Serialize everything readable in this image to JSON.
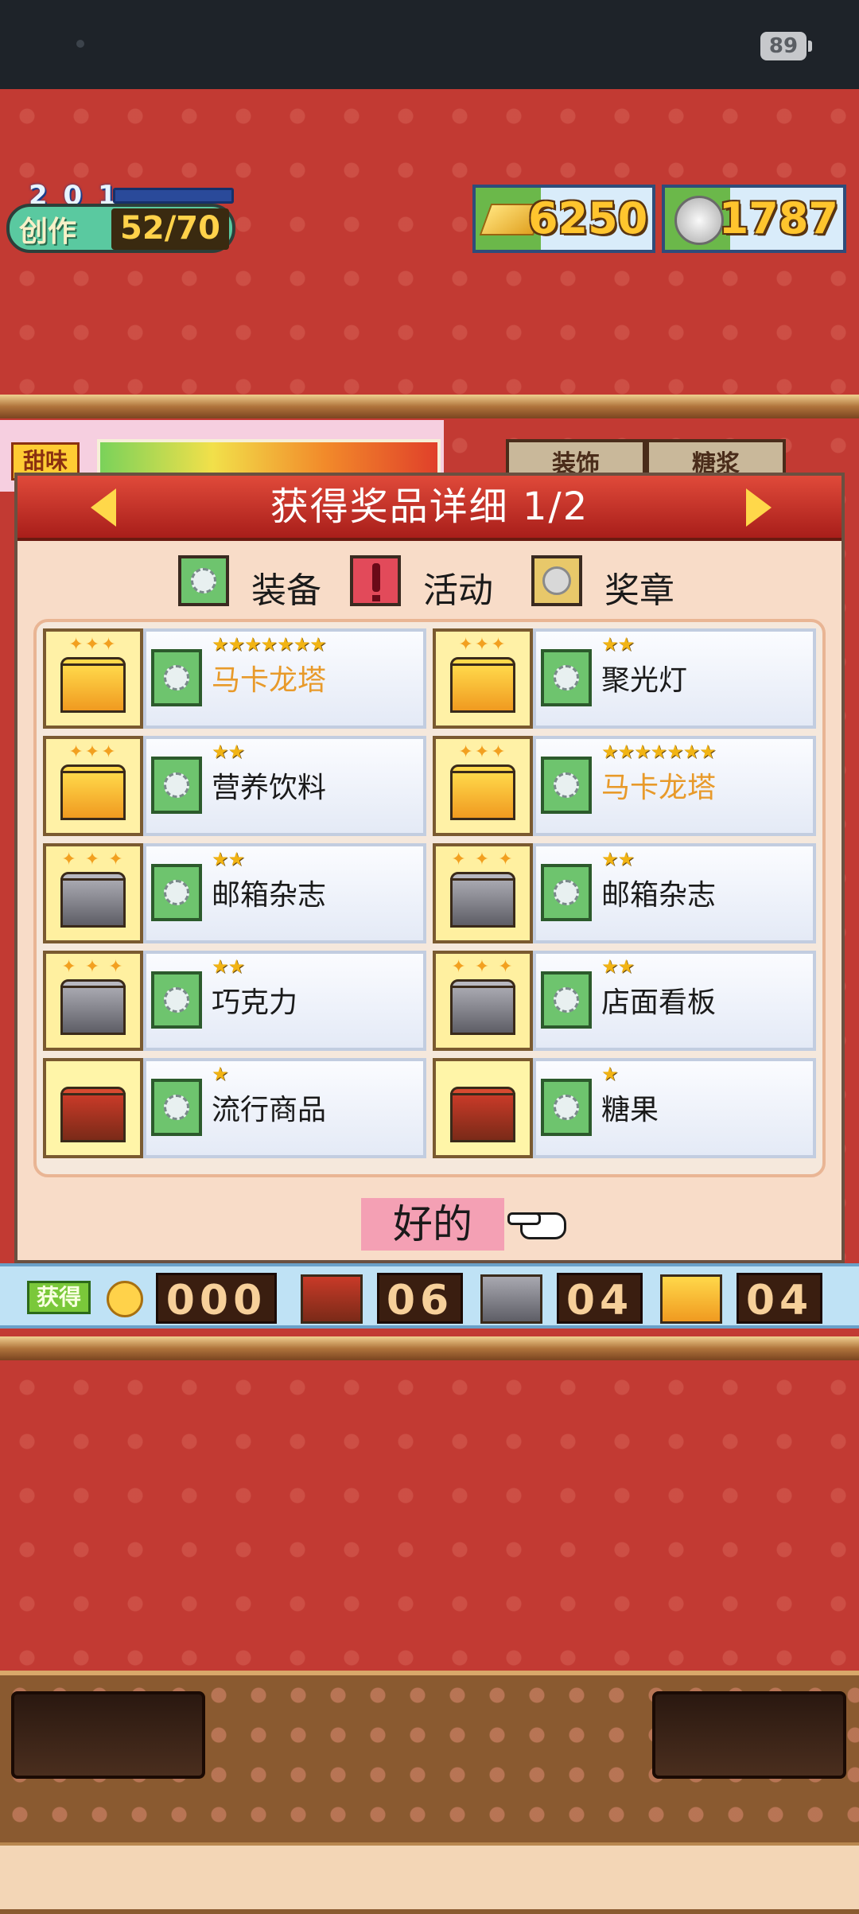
{
  "status_bar": {
    "battery": "89"
  },
  "hud": {
    "create": {
      "level": "2 0 1",
      "label": "创作",
      "value": "52/70"
    },
    "gold": {
      "value": "6250",
      "icon": "gold-bar-icon"
    },
    "silver": {
      "value": "1787",
      "icon": "silver-medal-icon"
    }
  },
  "scene": {
    "tag": "甜味",
    "buttons": [
      "装饰",
      "糖浆"
    ]
  },
  "dialog": {
    "title": "获得奖品详细 1/2",
    "legend": [
      {
        "label": "装备",
        "icon": "equipment-gear-icon",
        "color": "#6ec46e"
      },
      {
        "label": "活动",
        "icon": "event-exclamation-icon",
        "color": "#e24a5a"
      },
      {
        "label": "奖章",
        "icon": "medal-icon",
        "color": "#e8c86a"
      }
    ],
    "items": [
      {
        "chest": "gold",
        "stars": "★★★★★★★",
        "name": "马卡龙塔",
        "highlight": true
      },
      {
        "chest": "gold",
        "stars": "★★",
        "name": "聚光灯",
        "highlight": false
      },
      {
        "chest": "gold",
        "stars": "★★",
        "name": "营养饮料",
        "highlight": false
      },
      {
        "chest": "gold",
        "stars": "★★★★★★★",
        "name": "马卡龙塔",
        "highlight": true
      },
      {
        "chest": "silver",
        "stars": "★★",
        "name": "邮箱杂志",
        "highlight": false
      },
      {
        "chest": "silver",
        "stars": "★★",
        "name": "邮箱杂志",
        "highlight": false
      },
      {
        "chest": "silver",
        "stars": "★★",
        "name": "巧克力",
        "highlight": false
      },
      {
        "chest": "silver",
        "stars": "★★",
        "name": "店面看板",
        "highlight": false
      },
      {
        "chest": "bronze",
        "stars": "★",
        "name": "流行商品",
        "highlight": false
      },
      {
        "chest": "bronze",
        "stars": "★",
        "name": "糖果",
        "highlight": false
      }
    ],
    "ok_label": "好的"
  },
  "obtained": {
    "label": "获得",
    "coin_count": "000",
    "bronze_count": "06",
    "silver_count": "04",
    "gold_count": "04"
  },
  "colors": {
    "accent_red": "#c23a33",
    "header_red": "#a81e1a",
    "highlight_orange": "#e89a2a"
  }
}
